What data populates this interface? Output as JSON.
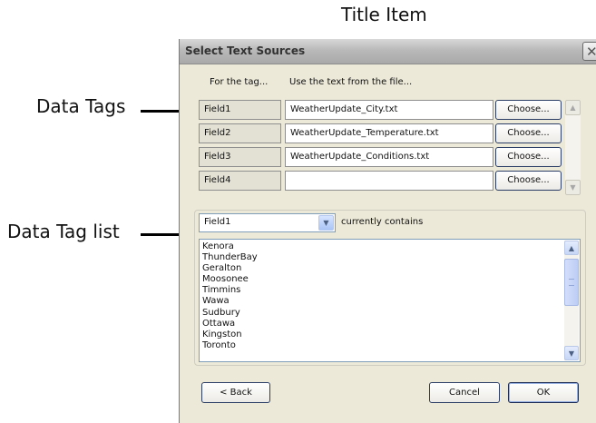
{
  "annotations": {
    "title_item": "Title Item",
    "data_tags": "Data Tags",
    "data_tag_list": "Data Tag list"
  },
  "dialog": {
    "title": "Select Text Sources",
    "close_glyph": "✕",
    "column_headers": {
      "tag": "For the tag...",
      "file": "Use the text from the file..."
    },
    "rows": [
      {
        "tag": "Field1",
        "file": "WeatherUpdate_City.txt",
        "button": "Choose..."
      },
      {
        "tag": "Field2",
        "file": "WeatherUpdate_Temperature.txt",
        "button": "Choose..."
      },
      {
        "tag": "Field3",
        "file": "WeatherUpdate_Conditions.txt",
        "button": "Choose..."
      },
      {
        "tag": "Field4",
        "file": "",
        "button": "Choose..."
      }
    ],
    "tag_select": {
      "value": "Field1",
      "suffix_label": "currently contains"
    },
    "contents": [
      "Kenora",
      "ThunderBay",
      "Geralton",
      "Moosonee",
      "Timmins",
      "Wawa",
      "Sudbury",
      "Ottawa",
      "Kingston",
      "Toronto"
    ],
    "buttons": {
      "back": "< Back",
      "cancel": "Cancel",
      "ok": "OK"
    }
  },
  "icons": {
    "scroll_up": "▲",
    "scroll_down": "▼",
    "dropdown": "▼"
  }
}
